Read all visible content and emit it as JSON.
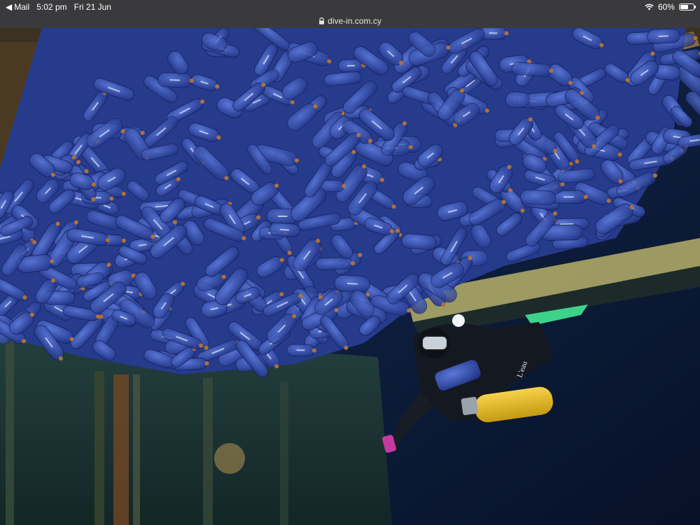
{
  "status_bar": {
    "back_app_label": "Mail",
    "time": "5:02 pm",
    "date": "Fri 21 Jun",
    "battery_percent_label": "60%",
    "battery_level": 0.6
  },
  "url_bar": {
    "domain": "dive-in.com.cy"
  },
  "photo": {
    "label_on_diver_tank": "L'eau"
  },
  "colors": {
    "chrome": "#3a3a3c",
    "water": "#0b1a33",
    "bottle_blue": "#2f4fb5"
  }
}
